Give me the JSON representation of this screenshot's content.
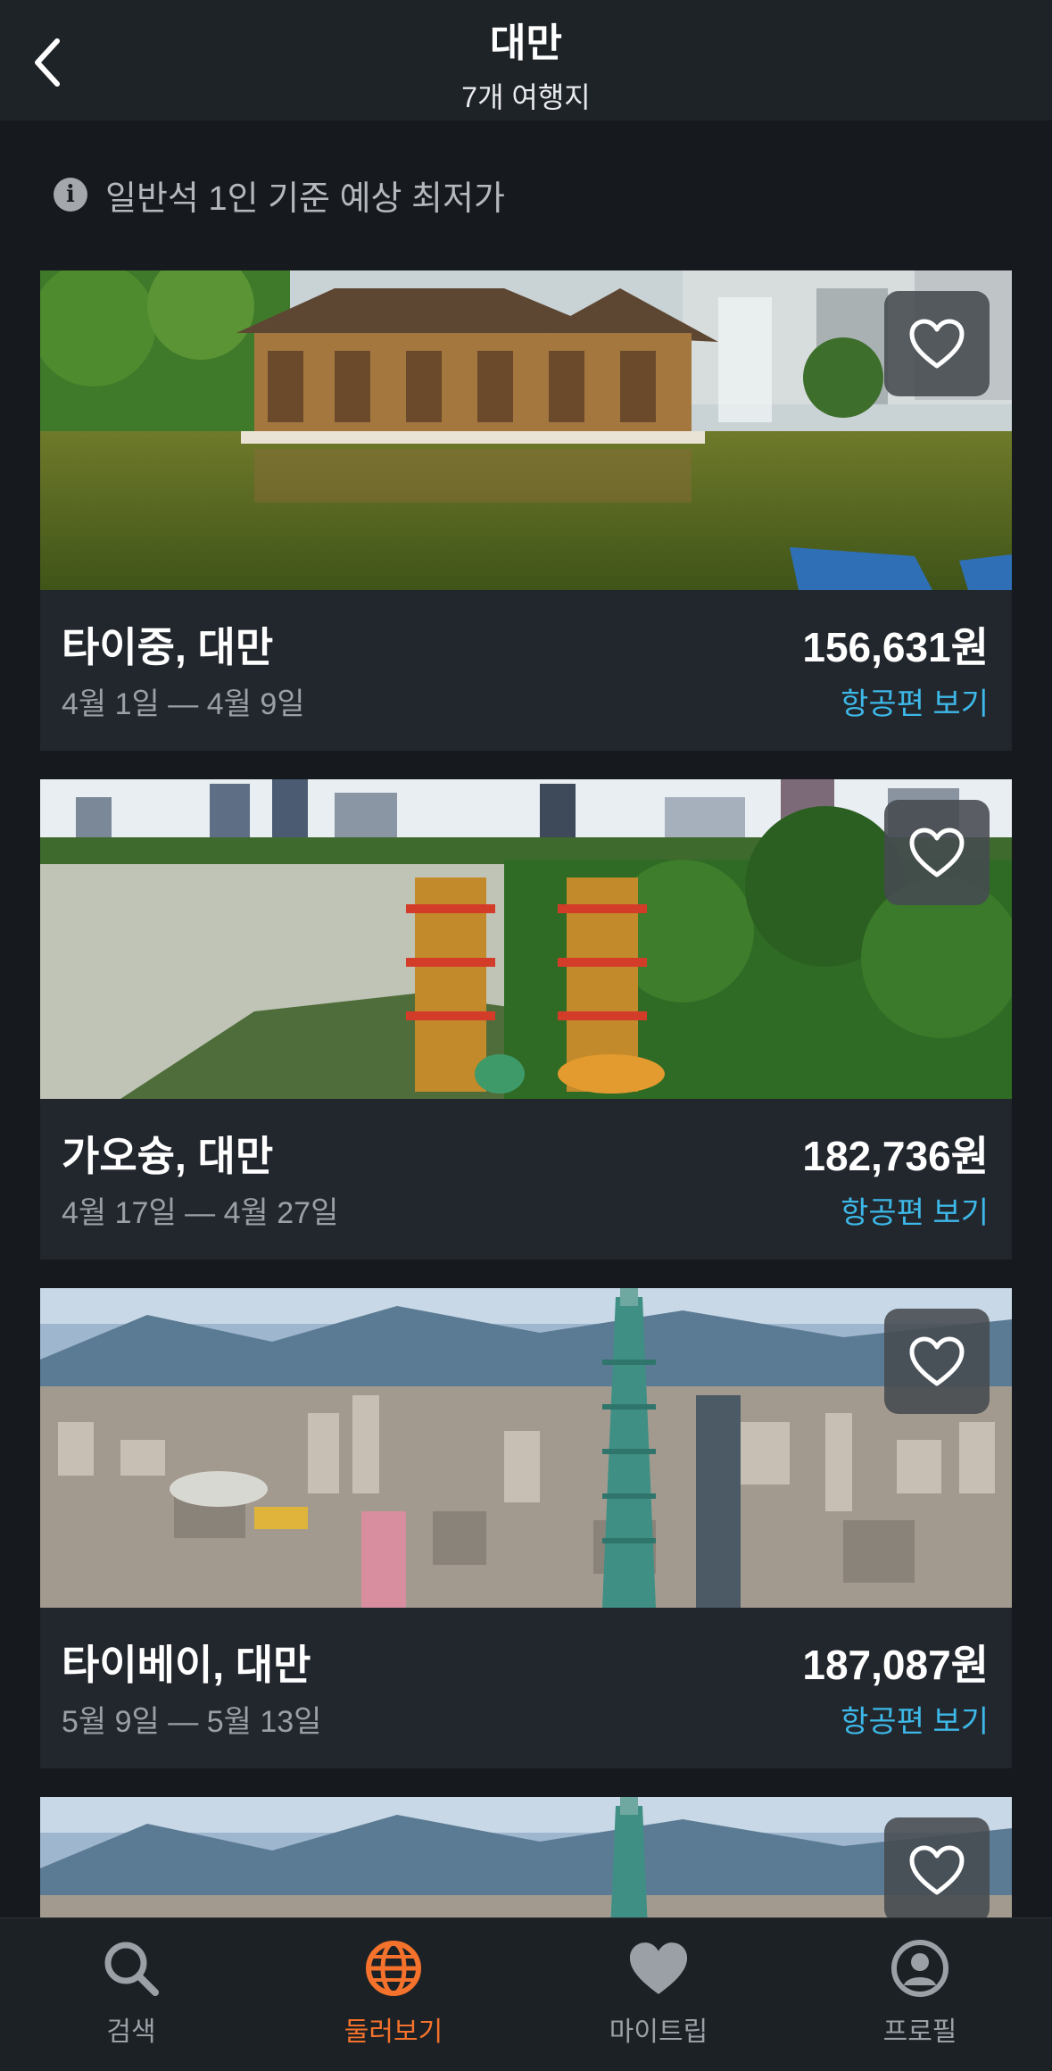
{
  "header": {
    "title": "대만",
    "subtitle": "7개 여행지"
  },
  "info": {
    "text": "일반석 1인 기준 예상 최저가"
  },
  "destinations": [
    {
      "city": "타이중, 대만",
      "dates": "4월 1일 — 4월 9일",
      "price": "156,631원",
      "link": "항공편 보기"
    },
    {
      "city": "가오슝, 대만",
      "dates": "4월 17일 — 4월 27일",
      "price": "182,736원",
      "link": "항공편 보기"
    },
    {
      "city": "타이베이, 대만",
      "dates": "5월 9일 — 5월 13일",
      "price": "187,087원",
      "link": "항공편 보기"
    }
  ],
  "tabs": [
    {
      "label": "검색",
      "icon": "search-icon"
    },
    {
      "label": "둘러보기",
      "icon": "globe-icon",
      "active": true
    },
    {
      "label": "마이트립",
      "icon": "heart-icon"
    },
    {
      "label": "프로필",
      "icon": "profile-icon"
    }
  ],
  "colors": {
    "accent": "#f4722b",
    "link": "#3db8e8",
    "background": "#16191d",
    "card": "#22272d"
  }
}
